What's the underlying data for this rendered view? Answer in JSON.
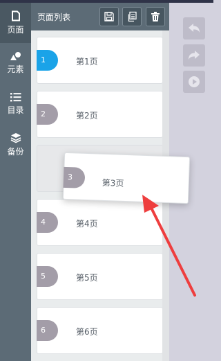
{
  "nav": {
    "items": [
      {
        "id": "pages",
        "label": "页面",
        "icon": "page-icon"
      },
      {
        "id": "elements",
        "label": "元素",
        "icon": "shapes-icon"
      },
      {
        "id": "toc",
        "label": "目录",
        "icon": "list-icon"
      },
      {
        "id": "backup",
        "label": "备份",
        "icon": "layers-icon"
      }
    ],
    "active": "pages"
  },
  "panel": {
    "title": "页面列表",
    "buttons": [
      {
        "id": "save",
        "icon": "save-icon"
      },
      {
        "id": "copy",
        "icon": "copy-icon"
      },
      {
        "id": "delete",
        "icon": "trash-icon"
      }
    ],
    "pages": [
      {
        "num": "1",
        "label": "第1页",
        "active": true
      },
      {
        "num": "2",
        "label": "第2页"
      },
      {
        "placeholder": true
      },
      {
        "num": "4",
        "label": "第4页"
      },
      {
        "num": "5",
        "label": "第5页"
      },
      {
        "num": "6",
        "label": "第6页"
      }
    ]
  },
  "dragging": {
    "num": "3",
    "label": "第3页"
  },
  "tools": [
    {
      "id": "undo",
      "icon": "undo-icon"
    },
    {
      "id": "redo",
      "icon": "redo-icon"
    },
    {
      "id": "preview",
      "icon": "play-icon"
    }
  ],
  "colors": {
    "nav_bg": "#5c6b76",
    "accent_active": "#1aa3e8",
    "page_pill": "#a39da8",
    "annotation_arrow": "#ee3e3e"
  }
}
